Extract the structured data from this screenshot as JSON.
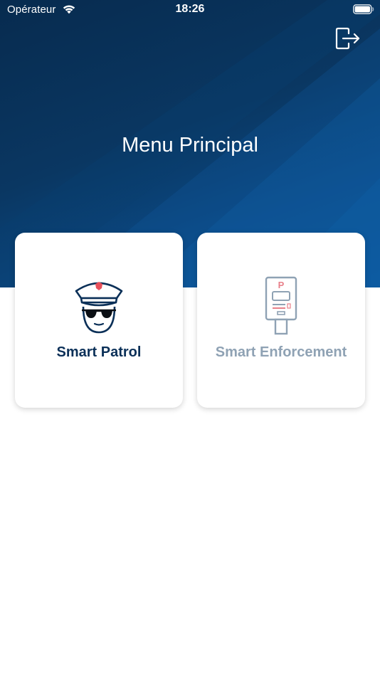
{
  "status_bar": {
    "carrier": "Opérateur",
    "time": "18:26",
    "wifi_icon": "wifi-icon",
    "battery_icon": "battery-icon"
  },
  "header": {
    "title": "Menu Principal",
    "logout_icon": "logout-icon"
  },
  "menu": {
    "items": [
      {
        "label": "Smart Patrol",
        "icon": "police-officer-icon",
        "enabled": true,
        "color": "#0b3058"
      },
      {
        "label": "Smart Enforcement",
        "icon": "parking-meter-icon",
        "enabled": false,
        "color": "#8fa2b4"
      }
    ]
  },
  "colors": {
    "header_dark": "#072b4f",
    "header_light": "#0c5396",
    "accent_red": "#e8505b",
    "card_background": "#ffffff"
  }
}
